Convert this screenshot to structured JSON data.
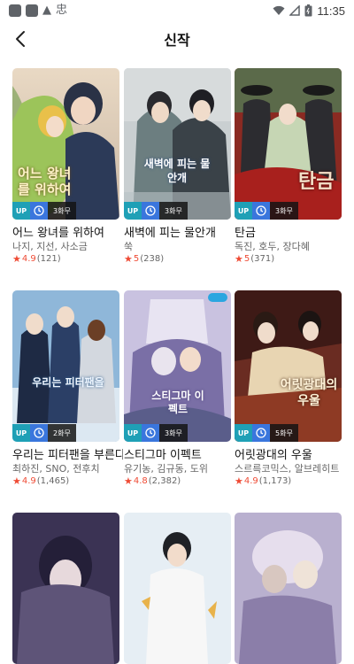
{
  "status_bar": {
    "time": "11:35",
    "carrier_glyph": "忠"
  },
  "app_bar": {
    "title": "신작",
    "back_icon": "arrow-back-icon"
  },
  "colors": {
    "up_badge": "#1fa0b6",
    "clock_badge": "#3a76dd",
    "rating": "#ef4b35"
  },
  "titles": [
    {
      "name": "어느 왕녀를 위하여",
      "authors": "나지, 지선, 사소금",
      "rating": "4.9",
      "count": "(121)",
      "up": "UP",
      "day": "3화무",
      "cover_text": "어느 왕녀를 위하여"
    },
    {
      "name": "새벽에 피는 물안개",
      "authors": "쑥",
      "rating": "5",
      "count": "(238)",
      "up": "UP",
      "day": "3화무",
      "cover_text": "새벽에 피는 물안개"
    },
    {
      "name": "탄금",
      "authors": "독진, 호두, 장다혜",
      "rating": "5",
      "count": "(371)",
      "up": "UP",
      "day": "3화무",
      "cover_text": "탄금"
    },
    {
      "name": "우리는 피터팬을 부른다",
      "authors": "최하진, SNO, 전후치",
      "rating": "4.9",
      "count": "(1,465)",
      "up": "UP",
      "day": "2화무",
      "cover_text": "우리는 피터팬을"
    },
    {
      "name": "스티그마 이펙트",
      "authors": "유기농, 김규동, 도위",
      "rating": "4.8",
      "count": "(2,382)",
      "up": "UP",
      "day": "3화무",
      "cover_text": "스티그마 이펙트"
    },
    {
      "name": "어릿광대의 우울",
      "authors": "스르륵코믹스, 알브레히트",
      "rating": "4.9",
      "count": "(1,173)",
      "up": "UP",
      "day": "5화무",
      "cover_text": "어릿광대의 우울"
    },
    {
      "name": "",
      "authors": "",
      "rating": "",
      "count": "",
      "up": "",
      "day": "",
      "cover_text": ""
    },
    {
      "name": "",
      "authors": "",
      "rating": "",
      "count": "",
      "up": "",
      "day": "",
      "cover_text": ""
    },
    {
      "name": "",
      "authors": "",
      "rating": "",
      "count": "",
      "up": "",
      "day": "",
      "cover_text": ""
    }
  ]
}
